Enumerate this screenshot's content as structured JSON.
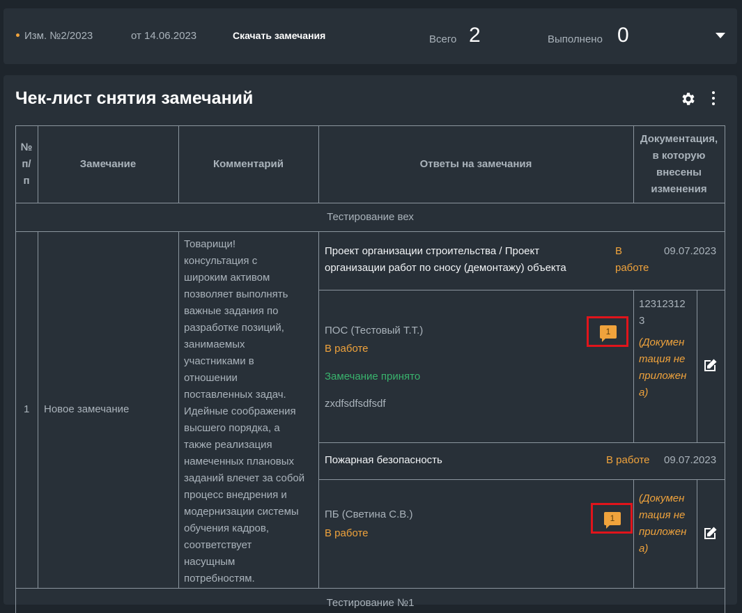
{
  "topbar": {
    "revision": "Изм. №2/2023",
    "date": "от 14.06.2023",
    "download": "Скачать замечания",
    "total_label": "Всего",
    "total_value": "2",
    "done_label": "Выполнено",
    "done_value": "0",
    "accent": "#f0a33c"
  },
  "panel": {
    "title": "Чек-лист снятия замечаний",
    "icons": [
      "gear-icon",
      "more-vertical-icon"
    ]
  },
  "table": {
    "headers": {
      "num": [
        "№",
        "п/",
        "п"
      ],
      "remark": "Замечание",
      "comment": "Комментарий",
      "answers": "Ответы на замечания",
      "docs": [
        "Документация,",
        "в которую",
        "внесены",
        "изменения"
      ]
    },
    "group1": "Тестирование вех",
    "row1": {
      "num": "1",
      "remark": "Новое замечание",
      "comment": [
        "Товарищи!",
        "консультация с",
        "широким активом",
        "позволяет выполнять",
        "важные задания по",
        "разработке позиций,",
        "занимаемых",
        "участниками в",
        "отношении",
        "поставленных задач.",
        "Идейные соображения",
        "высшего порядка, а",
        "также реализация",
        "намеченных плановых",
        "заданий влечет за собой",
        "процесс внедрения и",
        "модернизации системы",
        "обучения кадров,",
        "соответствует",
        "насущным",
        "потребностям."
      ],
      "section1": {
        "title": [
          "Проект организации строительства / Проект",
          "организации работ по сносу (демонтажу) объекта"
        ],
        "status": [
          "В",
          "работе"
        ],
        "date": "09.07.2023",
        "answer": {
          "author": "ПОС (Тестовый Т.Т.)",
          "status": "В работе",
          "accepted": "Замечание принято",
          "text": "zxdfsdfsdfsdf",
          "comments": "1",
          "doc_number": [
            "12312312",
            "3"
          ],
          "doc_missing": [
            "(Докумен",
            "тация не",
            "приложен",
            "а)"
          ]
        }
      },
      "section2": {
        "title": "Пожарная безопасность",
        "status": "В работе",
        "date": "09.07.2023",
        "answer": {
          "author": "ПБ (Светина С.В.)",
          "status": "В работе",
          "comments": "1",
          "doc_missing": [
            "(Докумен",
            "тация не",
            "приложен",
            "а)"
          ]
        }
      }
    },
    "group2": "Тестирование №1"
  }
}
